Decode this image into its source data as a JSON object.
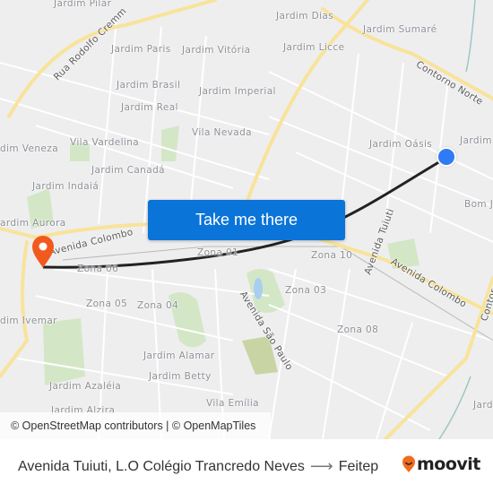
{
  "map": {
    "neighborhoods": [
      {
        "id": "jardim-pilar",
        "label": "Jardim Pilar"
      },
      {
        "id": "jardim-dias",
        "label": "Jardim Dias"
      },
      {
        "id": "jardim-sumare",
        "label": "Jardim Sumaré"
      },
      {
        "id": "jardim-paris",
        "label": "Jardim Paris"
      },
      {
        "id": "jardim-vitoria",
        "label": "Jardim Vitória"
      },
      {
        "id": "jardim-licce",
        "label": "Jardim Licce"
      },
      {
        "id": "jardim-brasil",
        "label": "Jardim Brasil"
      },
      {
        "id": "jardim-imperial",
        "label": "Jardim Imperial"
      },
      {
        "id": "jardim-real",
        "label": "Jardim Real"
      },
      {
        "id": "vila-nevada",
        "label": "Vila Nevada"
      },
      {
        "id": "vila-vardelina",
        "label": "Vila Vardelina"
      },
      {
        "id": "jardim-veneza",
        "label": "dim Veneza"
      },
      {
        "id": "jardim-oasis",
        "label": "Jardim Oásis"
      },
      {
        "id": "jardim-e",
        "label": "Jardim"
      },
      {
        "id": "jardim-canada",
        "label": "Jardim Canadá"
      },
      {
        "id": "jardim-indaia",
        "label": "Jardim Indaiá"
      },
      {
        "id": "bom-j",
        "label": "Bom J"
      },
      {
        "id": "jardim-aurora",
        "label": "ardim Aurora"
      },
      {
        "id": "zona-01",
        "label": "Zona 01"
      },
      {
        "id": "zona-06",
        "label": "Zona 06"
      },
      {
        "id": "zona-10",
        "label": "Zona 10"
      },
      {
        "id": "zona-05",
        "label": "Zona 05"
      },
      {
        "id": "zona-04",
        "label": "Zona 04"
      },
      {
        "id": "zona-03",
        "label": "Zona 03"
      },
      {
        "id": "jardim-ivemar",
        "label": "dim Ivemar"
      },
      {
        "id": "zona-08",
        "label": "Zona 08"
      },
      {
        "id": "jardim-alamar",
        "label": "Jardim Alamar"
      },
      {
        "id": "jardim-betty",
        "label": "Jardim Betty"
      },
      {
        "id": "jardim-azaleia",
        "label": "Jardim Azaléia"
      },
      {
        "id": "vila-emilia",
        "label": "Vila Emília"
      },
      {
        "id": "jardim-alzira",
        "label": "Jardim Alzira"
      },
      {
        "id": "jardim-se",
        "label": "Jardi"
      }
    ],
    "roads": [
      {
        "id": "rua-rodolfo-cremm",
        "label": "Rua Rodolfo Cremm"
      },
      {
        "id": "contorno-norte",
        "label": "Contorno Norte"
      },
      {
        "id": "avenida-colombo-west",
        "label": "Avenida Colombo"
      },
      {
        "id": "avenida-colombo-east",
        "label": "Avenida Colombo"
      },
      {
        "id": "avenida-tuiuti",
        "label": "Avenida Tuiuti"
      },
      {
        "id": "avenida-sao-paulo",
        "label": "Avenida São Paulo"
      },
      {
        "id": "contorno-east",
        "label": "Contor"
      }
    ],
    "attribution": "© OpenStreetMap contributors | © OpenMapTiles",
    "cta_label": "Take me there",
    "colors": {
      "route": "#222222",
      "origin": "#2f7bf5",
      "destination": "#f25a1d",
      "button": "#0a74d8",
      "major_road": "#f8e39a",
      "park": "#cfe5c2"
    }
  },
  "footer": {
    "origin": "Avenida Tuiuti, L.O Colégio Trancredo Neves",
    "arrow": "⟶",
    "destination": "Feitep",
    "brand": "moovit"
  }
}
